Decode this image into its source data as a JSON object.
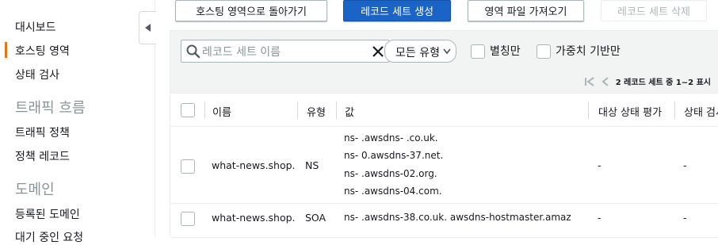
{
  "sidebar": {
    "items": [
      {
        "label": "대시보드"
      },
      {
        "label": "호스팅 영역"
      },
      {
        "label": "상태 검사"
      },
      {
        "label": "트래픽 정책"
      },
      {
        "label": "정책 레코드"
      },
      {
        "label": "등록된 도메인"
      },
      {
        "label": "대기 중인 요청"
      }
    ],
    "sections": [
      {
        "label": "트래픽 흐름"
      },
      {
        "label": "도메인"
      }
    ],
    "active_accent": "#ec7211"
  },
  "toolbar": {
    "back_label": "호스팅 영역으로 돌아가기",
    "create_label": "레코드 세트 생성",
    "import_label": "영역 파일 가져오기",
    "delete_label": "레코드 세트 삭제"
  },
  "filter": {
    "search_placeholder": "레코드 세트 이름",
    "type_select": "모든 유형",
    "alias_only": "별칭만",
    "weighted_only": "가중치 기반만"
  },
  "pager": {
    "summary": "2 레코드 세트 중 1~2 표시"
  },
  "table": {
    "columns": [
      "이름",
      "유형",
      "값",
      "대상 상태 평가",
      "상태 검사"
    ],
    "rows": [
      {
        "name": "what-news.shop.",
        "type": "NS",
        "values": [
          "ns-     .awsdns-  .co.uk.",
          "ns-  0.awsdns-37.net.",
          "ns-      .awsdns-02.org.",
          "ns-   .awsdns-04.com."
        ],
        "eval": "-",
        "health": "-"
      },
      {
        "name": "what-news.shop.",
        "type": "SOA",
        "values": [
          "ns-      .awsdns-38.co.uk. awsdns-hostmaster.amaz"
        ],
        "eval": "-",
        "health": "-"
      }
    ]
  }
}
